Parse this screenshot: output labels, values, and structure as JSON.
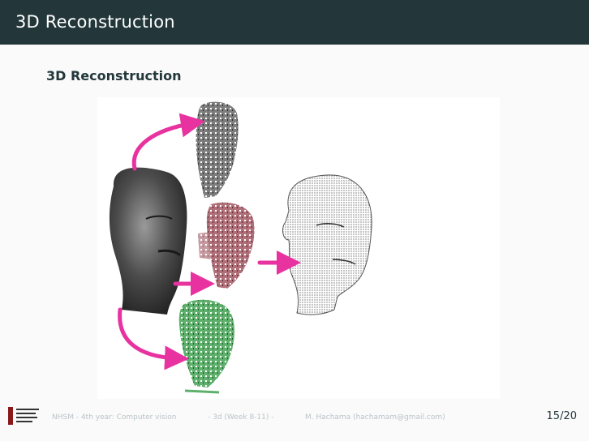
{
  "slide": {
    "title": "3D Reconstruction",
    "frame_title": "3D Reconstruction"
  },
  "footer": {
    "course": "NHSM - 4th year: Computer vision",
    "session": "- 3d (Week 8-11) -",
    "author": "M. Hachama (hachamam@gmail.com)",
    "page": "15/20"
  },
  "colors": {
    "header_bg": "#23373b",
    "arrow": "#e832a0",
    "footer_text": "#b9c3c8"
  },
  "figure": {
    "icons": [
      "bronze-head-icon",
      "grey-partial-scan-icon",
      "red-partial-scan-icon",
      "green-partial-scan-icon",
      "point-cloud-head-icon",
      "magenta-arrow-icon"
    ]
  }
}
